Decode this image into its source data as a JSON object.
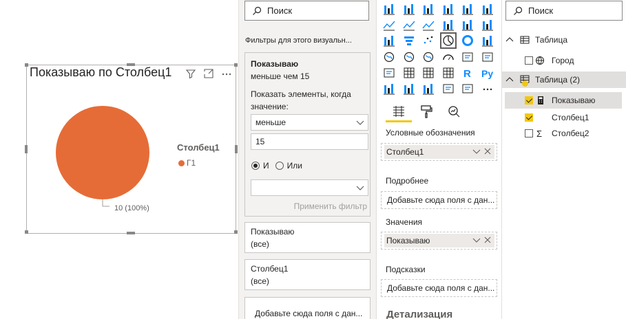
{
  "visual": {
    "title": "Показываю по Столбец1",
    "legend_title": "Столбец1",
    "legend_item": "Г1",
    "slice_label": "10 (100%)",
    "slice_color": "#e66c37"
  },
  "chart_data": {
    "type": "pie",
    "title": "Показываю по Столбец1",
    "legend_title": "Столбец1",
    "categories": [
      "Г1"
    ],
    "values": [
      10
    ],
    "labels": [
      "10 (100%)"
    ],
    "colors": [
      "#e66c37"
    ]
  },
  "filters": {
    "search_placeholder": "Поиск",
    "section_title": "Фильтры для этого визуальн...",
    "card": {
      "title": "Показываю",
      "summary": "меньше чем 15",
      "prompt": "Показать элементы, когда значение:",
      "operator": "меньше",
      "value": "15",
      "and_label": "И",
      "or_label": "Или",
      "second_operator": "",
      "apply_label": "Применить фильтр"
    },
    "other_cards": [
      {
        "title": "Показываю",
        "sub": "(все)"
      },
      {
        "title": "Столбец1",
        "sub": "(все)"
      }
    ],
    "add_fields": "Добавьте сюда поля с дан..."
  },
  "viz": {
    "legend_label": "Условные обозначения",
    "legend_field": "Столбец1",
    "details_label": "Подробнее",
    "details_placeholder": "Добавьте сюда поля с дан...",
    "values_label": "Значения",
    "values_field": "Показываю",
    "tooltips_label": "Подсказки",
    "tooltips_placeholder": "Добавьте сюда поля с дан...",
    "drill_title": "Детализация",
    "accent": "#f2c811"
  },
  "fields": {
    "search_placeholder": "Поиск",
    "tables": [
      {
        "name": "Таблица",
        "fields": [
          {
            "name": "Город",
            "checked": false
          }
        ]
      },
      {
        "name": "Таблица (2)",
        "fields": [
          {
            "name": "Показываю",
            "checked": true
          },
          {
            "name": "Столбец1",
            "checked": true
          },
          {
            "name": "Столбец2",
            "checked": false
          }
        ]
      }
    ]
  }
}
